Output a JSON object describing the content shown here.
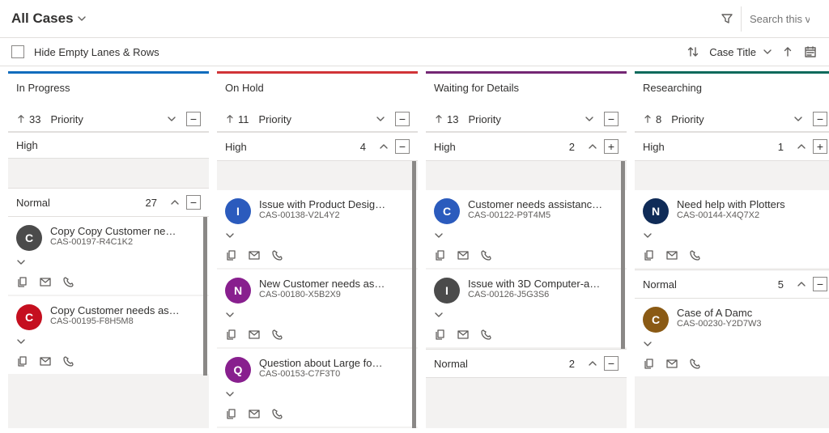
{
  "header": {
    "view_title": "All Cases",
    "search_placeholder": "Search this view"
  },
  "toolbar": {
    "hide_label": "Hide Empty Lanes & Rows",
    "sort_label": "Case Title"
  },
  "columns": [
    {
      "title": "In Progress",
      "accent": "#0f6cbd",
      "count": "33",
      "priority_label": "Priority",
      "swimlanes": [
        {
          "label": "High",
          "count": "",
          "expand": "none",
          "cards": []
        },
        {
          "label": "Normal",
          "count": "27",
          "expand": "collapse",
          "cards": [
            {
              "avatar_bg": "#4b4b4b",
              "avatar_letter": "C",
              "title": "Copy Copy Customer ne…",
              "sub": "CAS-00197-R4C1K2"
            },
            {
              "avatar_bg": "#c50f1f",
              "avatar_letter": "C",
              "title": "Copy Customer needs as…",
              "sub": "CAS-00195-F8H5M8"
            }
          ]
        }
      ]
    },
    {
      "title": "On Hold",
      "accent": "#d13438",
      "count": "11",
      "priority_label": "Priority",
      "swimlanes": [
        {
          "label": "High",
          "count": "4",
          "expand": "collapse",
          "cards": [
            {
              "avatar_bg": "#2b5bbd",
              "avatar_letter": "I",
              "title": "Issue with Product Desig…",
              "sub": "CAS-00138-V2L4Y2"
            },
            {
              "avatar_bg": "#881f8e",
              "avatar_letter": "N",
              "title": "New Customer needs as…",
              "sub": "CAS-00180-X5B2X9"
            },
            {
              "avatar_bg": "#881f8e",
              "avatar_letter": "Q",
              "title": "Question about Large fo…",
              "sub": "CAS-00153-C7F3T0"
            }
          ]
        }
      ]
    },
    {
      "title": "Waiting for Details",
      "accent": "#742774",
      "count": "13",
      "priority_label": "Priority",
      "swimlanes": [
        {
          "label": "High",
          "count": "2",
          "expand": "expand",
          "cards": [
            {
              "avatar_bg": "#2b5bbd",
              "avatar_letter": "C",
              "title": "Customer needs assistanc…",
              "sub": "CAS-00122-P9T4M5"
            },
            {
              "avatar_bg": "#4b4b4b",
              "avatar_letter": "I",
              "title": "Issue with 3D Computer-a…",
              "sub": "CAS-00126-J5G3S6"
            }
          ]
        },
        {
          "label": "Normal",
          "count": "2",
          "expand": "collapse",
          "cards": []
        }
      ]
    },
    {
      "title": "Researching",
      "accent": "#0b6a5c",
      "count": "8",
      "priority_label": "Priority",
      "swimlanes": [
        {
          "label": "High",
          "count": "1",
          "expand": "expand",
          "cards": [
            {
              "avatar_bg": "#0f2b57",
              "avatar_letter": "N",
              "title": "Need help with Plotters",
              "sub": "CAS-00144-X4Q7X2"
            }
          ]
        },
        {
          "label": "Normal",
          "count": "5",
          "expand": "collapse",
          "cards": [
            {
              "avatar_bg": "#8a5a14",
              "avatar_letter": "C",
              "title": "Case of A Damc",
              "sub": "CAS-00230-Y2D7W3"
            }
          ]
        }
      ]
    }
  ]
}
